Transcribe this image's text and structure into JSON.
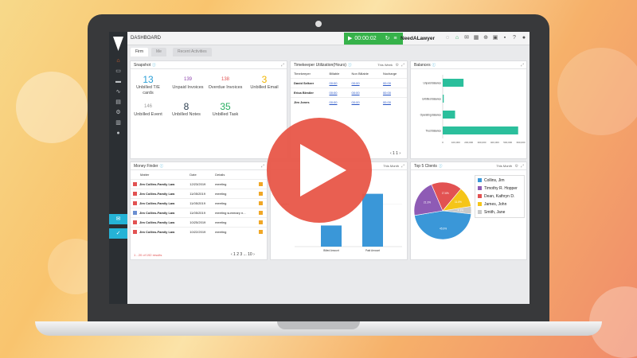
{
  "app": {
    "page_title": "DASHBOARD",
    "timer": "00:00:02",
    "brand": "NeedALawyer"
  },
  "tabs": [
    {
      "label": "Firm",
      "active": true
    },
    {
      "label": "Me",
      "active": false
    },
    {
      "label": "Recent Activities",
      "active": false
    }
  ],
  "snapshot": {
    "title": "Snapshot",
    "items": [
      {
        "value": "13",
        "label": "Unbilled T/E cards",
        "color": "#2a9fd6"
      },
      {
        "value": "139",
        "label": "Unpaid Invoices",
        "color": "#8e44ad"
      },
      {
        "value": "138",
        "label": "Overdue Invoices",
        "color": "#e25252"
      },
      {
        "value": "3",
        "label": "Unbilled Email",
        "color": "#f0b400"
      },
      {
        "value": "146",
        "label": "Unbilled Event",
        "color": "#999999"
      },
      {
        "value": "8",
        "label": "Unbilled Notes",
        "color": "#2c3e50"
      },
      {
        "value": "35",
        "label": "Unbilled Task",
        "color": "#27ae60"
      }
    ]
  },
  "timekeeper": {
    "title": "Timekeeper Utilization(Hours)",
    "period": "This Week",
    "columns": [
      "Timekeeper",
      "Billable",
      "Non Billable",
      "Nocharge"
    ],
    "rows": [
      {
        "name": "David Seltzer",
        "billable": "00:00",
        "non_billable": "00:00",
        "nocharge": "00:00"
      },
      {
        "name": "Erica Birstler",
        "billable": "00:00",
        "non_billable": "00:00",
        "nocharge": "00:00"
      },
      {
        "name": "Jim Jones",
        "billable": "00:00",
        "non_billable": "00:00",
        "nocharge": "00:00"
      }
    ],
    "pager": "‹ 1 1 ›"
  },
  "balances": {
    "title": "Balances",
    "chart_data": {
      "type": "bar",
      "orientation": "horizontal",
      "categories": [
        "Unpaid Balance",
        "Unbilled Balance",
        "Operating Balance",
        "Trust Balance"
      ],
      "values": [
        160000,
        8000,
        95000,
        580000
      ],
      "xlim": [
        0,
        600000
      ],
      "xticks": [
        "0",
        "100,000",
        "200,000",
        "300,000",
        "400,000",
        "500,000",
        "600,000"
      ],
      "color": "#2bbf9c"
    }
  },
  "money_finder": {
    "title": "Money Finder",
    "columns": [
      "Matter",
      "Date",
      "Details"
    ],
    "rows": [
      {
        "matter": "Jim Collins-Family Law",
        "date": "12/23/2019",
        "details": "meeting"
      },
      {
        "matter": "Jim Collins-Family Law",
        "date": "11/05/2019",
        "details": "meeting"
      },
      {
        "matter": "Jim Collins-Family Law",
        "date": "11/05/2019",
        "details": "meeting"
      },
      {
        "matter": "Jim Collins-Family Law",
        "date": "11/05/2019",
        "details": "meeting summary n..."
      },
      {
        "matter": "Jim Collins-Family Law",
        "date": "10/25/2019",
        "details": "meeting"
      },
      {
        "matter": "Jim Collins-Family Law",
        "date": "10/22/2019",
        "details": "meeting"
      }
    ],
    "results": "1 - 20 of 192 results",
    "pager": "‹ 1 2 3 ... 10 ›"
  },
  "billed_chart": {
    "period": "This Month",
    "chart_data": {
      "type": "bar",
      "categories": [
        "Billed Amount",
        "Paid Amount"
      ],
      "values": [
        5000,
        12500
      ],
      "ytick": "10,000",
      "ylim": [
        0,
        16000
      ],
      "color": "#3a97d8"
    }
  },
  "top_clients": {
    "title": "Top 5 Clients",
    "period": "This Month",
    "chart_data": {
      "type": "pie",
      "labels": [
        "Collins, Jim",
        "Timothy R. Hopper",
        "Dean, Kathryn D.",
        "James, John",
        "Smith, Jane"
      ],
      "values": [
        45.9,
        21.3,
        17.6,
        11.5,
        4.3
      ],
      "data_labels": [
        "45.9%",
        "21.3%",
        "17.6%",
        "11.5%",
        "4.3%"
      ],
      "colors": [
        "#3a97d8",
        "#8e5bb5",
        "#e25252",
        "#f5c518",
        "#c9c9c9"
      ]
    }
  }
}
